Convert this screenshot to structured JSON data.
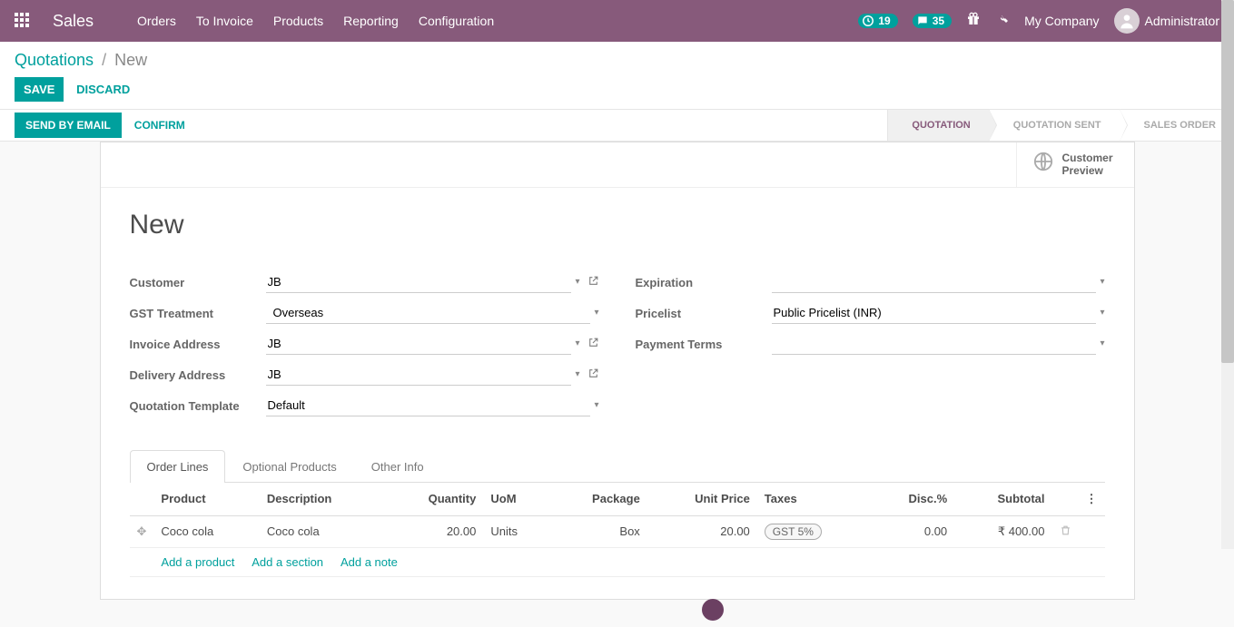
{
  "nav": {
    "brand": "Sales",
    "menu": [
      "Orders",
      "To Invoice",
      "Products",
      "Reporting",
      "Configuration"
    ],
    "activity_count": "19",
    "message_count": "35",
    "company": "My Company",
    "user": "Administrator"
  },
  "breadcrumb": {
    "root": "Quotations",
    "current": "New"
  },
  "buttons": {
    "save": "SAVE",
    "discard": "DISCARD",
    "send": "SEND BY EMAIL",
    "confirm": "CONFIRM"
  },
  "status_steps": {
    "quotation": "QUOTATION",
    "sent": "QUOTATION SENT",
    "order": "SALES ORDER"
  },
  "stat_button": {
    "line1": "Customer",
    "line2": "Preview"
  },
  "title": "New",
  "form": {
    "customer_label": "Customer",
    "customer": "JB",
    "gst_label": "GST Treatment",
    "gst": "Overseas",
    "invoice_addr_label": "Invoice Address",
    "invoice_addr": "JB",
    "delivery_addr_label": "Delivery Address",
    "delivery_addr": "JB",
    "template_label": "Quotation Template",
    "template": "Default",
    "expiration_label": "Expiration",
    "expiration": "",
    "pricelist_label": "Pricelist",
    "pricelist": "Public Pricelist (INR)",
    "payment_terms_label": "Payment Terms",
    "payment_terms": ""
  },
  "tabs": {
    "lines": "Order Lines",
    "optional": "Optional Products",
    "other": "Other Info"
  },
  "columns": {
    "product": "Product",
    "description": "Description",
    "qty": "Quantity",
    "uom": "UoM",
    "package": "Package",
    "price": "Unit Price",
    "taxes": "Taxes",
    "disc": "Disc.%",
    "subtotal": "Subtotal"
  },
  "line": {
    "product": "Coco cola",
    "description": "Coco cola",
    "qty": "20.00",
    "uom": "Units",
    "package": "Box",
    "price": "20.00",
    "tax": "GST 5%",
    "disc": "0.00",
    "subtotal": "₹ 400.00"
  },
  "add": {
    "product": "Add a product",
    "section": "Add a section",
    "note": "Add a note"
  },
  "chart_data": null
}
